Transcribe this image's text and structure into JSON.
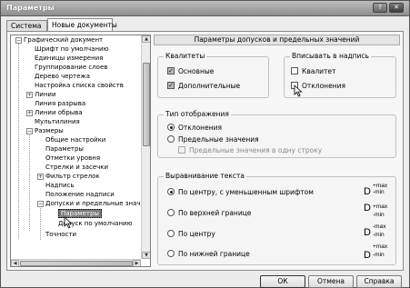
{
  "window": {
    "title": "Параметры",
    "help": "?",
    "close": "✕"
  },
  "tabs": [
    {
      "label": "Система"
    },
    {
      "label": "Новые документы"
    }
  ],
  "tree": {
    "items": [
      {
        "label": "Графический документ"
      },
      {
        "label": "Шрифт по умолчанию"
      },
      {
        "label": "Единицы измерения"
      },
      {
        "label": "Группирование слоев"
      },
      {
        "label": "Дерево чертежа"
      },
      {
        "label": "Настройка списка свойств"
      },
      {
        "label": "Линии"
      },
      {
        "label": "Линия разрыва"
      },
      {
        "label": "Линии обрыва"
      },
      {
        "label": "Мультилиния"
      },
      {
        "label": "Размеры"
      },
      {
        "label": "Общие настройки"
      },
      {
        "label": "Параметры"
      },
      {
        "label": "Отметки уровня"
      },
      {
        "label": "Стрелки и засечки"
      },
      {
        "label": "Фильтр стрелок"
      },
      {
        "label": "Надпись"
      },
      {
        "label": "Положение надписи"
      },
      {
        "label": "Допуски и предельные знач"
      },
      {
        "label": "Параметры"
      },
      {
        "label": "Допуск по умолчанию"
      },
      {
        "label": "Точности"
      }
    ]
  },
  "panel": {
    "header": "Параметры допусков и предельных значений",
    "kvalitety": {
      "title": "Квалитеты",
      "basic": {
        "label": "Основные",
        "checked": true
      },
      "additional": {
        "label": "Дополнительные",
        "checked": true
      }
    },
    "inscribe": {
      "title": "Вписывать в надпись",
      "kvalitet": {
        "label": "Квалитет",
        "checked": false
      },
      "deviations": {
        "label": "Отклонения",
        "checked": false
      }
    },
    "display": {
      "title": "Тип отображения",
      "deviations": {
        "label": "Отклонения",
        "selected": true
      },
      "limits": {
        "label": "Предельные значения",
        "selected": false
      },
      "one_line": {
        "label": "Предельные значения в одну строку",
        "checked": false
      }
    },
    "align": {
      "title": "Выравнивание текста",
      "options": [
        {
          "label": "По центру, с уменьшенным шрифтом",
          "selected": true,
          "base": "D",
          "top": "+max",
          "bottom": "-min"
        },
        {
          "label": "По верхней границе",
          "selected": false,
          "base": "D",
          "top": "+max",
          "bottom": "-min"
        },
        {
          "label": "По центру",
          "selected": false,
          "base": "D",
          "top": "-max",
          "bottom": "-min"
        },
        {
          "label": "По нижней границе",
          "selected": false,
          "base": "D",
          "top": "+max",
          "bottom": "-min"
        }
      ]
    }
  },
  "buttons": {
    "ok": "ОК",
    "cancel": "Отмена",
    "help": "Справка"
  }
}
